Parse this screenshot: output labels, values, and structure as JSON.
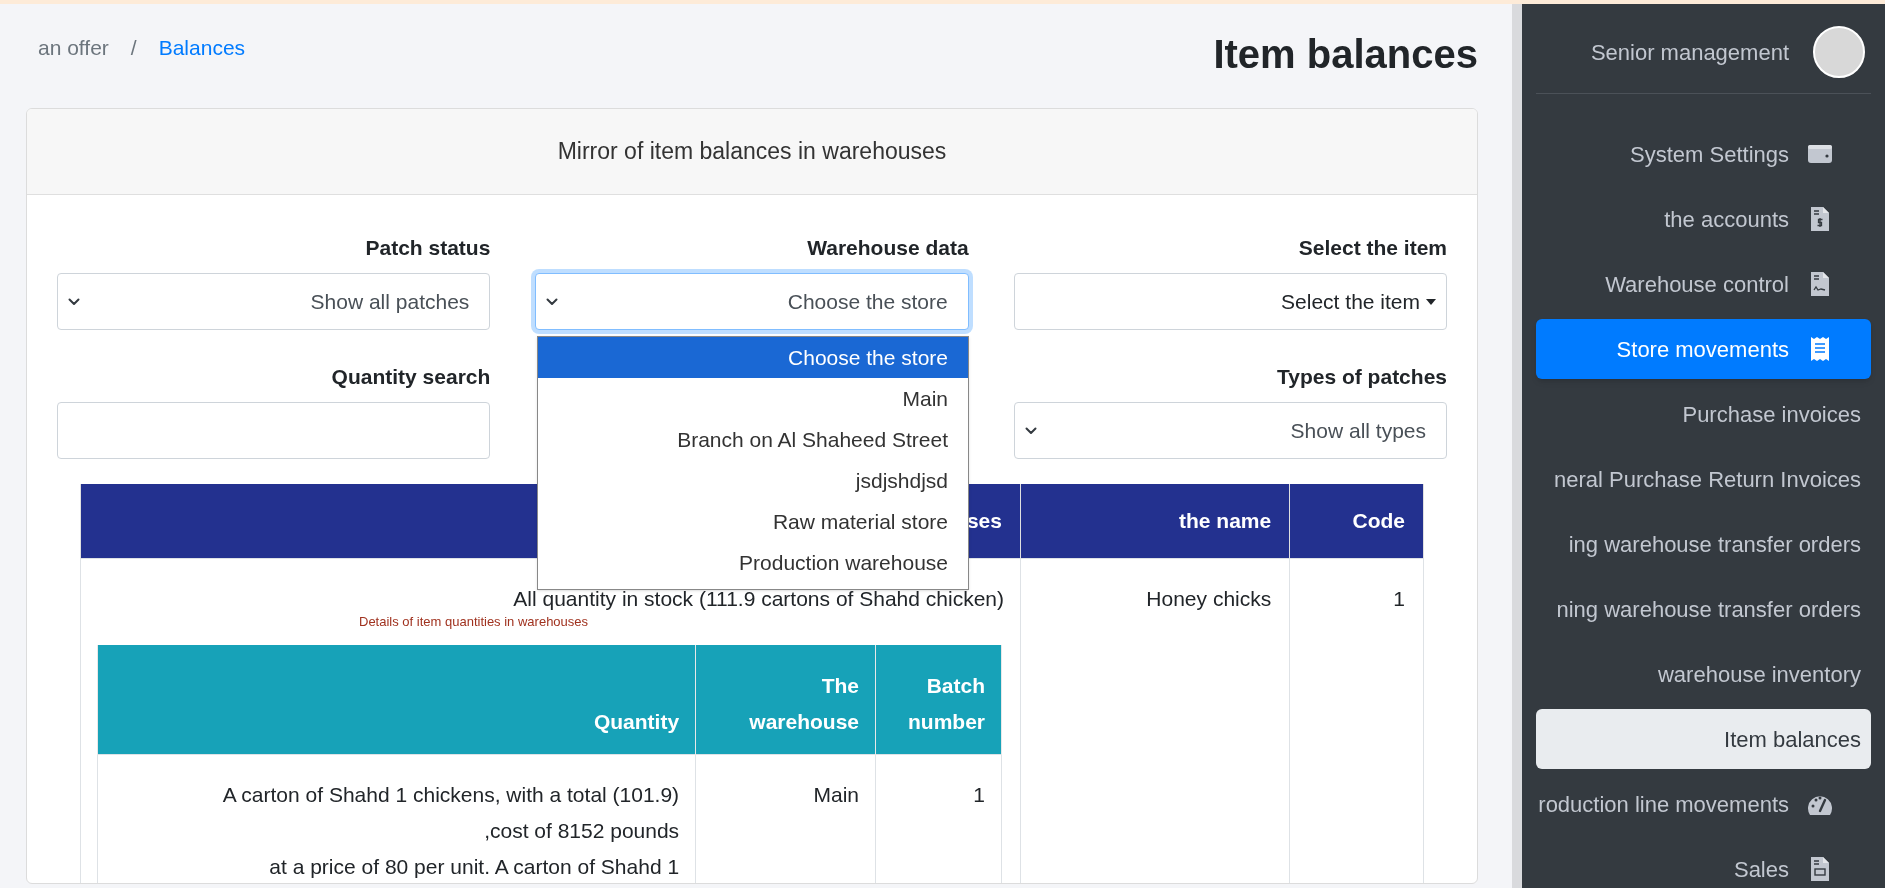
{
  "breadcrumb": {
    "separator": "/",
    "items": [
      {
        "label": "an offer",
        "link": false
      },
      {
        "label": "Balances",
        "link": true
      }
    ]
  },
  "page_title": "Item balances",
  "card": {
    "title": "Mirror of item balances in warehouses",
    "filters": [
      {
        "label": "Patch status",
        "kind": "select",
        "value": "Show all patches",
        "focused": false
      },
      {
        "label": "Warehouse data",
        "kind": "select",
        "value": "Choose the store",
        "focused": true
      },
      {
        "label": "Select the item",
        "kind": "picker",
        "value": "Select the item",
        "focused": false
      },
      {
        "label": "Quantity search",
        "kind": "input",
        "focused": false
      },
      {
        "kind": "hidden"
      },
      {
        "label": "Types of patches",
        "kind": "select",
        "value": "Show all types",
        "focused": false
      }
    ],
    "dropdown_options": [
      {
        "label": "Choose the store",
        "selected": true
      },
      {
        "label": "Main",
        "selected": false
      },
      {
        "label": "Branch on Al Shaheed Street",
        "selected": false
      },
      {
        "label": "jsdjshdjsd",
        "selected": false
      },
      {
        "label": "Raw material store",
        "selected": false
      },
      {
        "label": "Production warehouse",
        "selected": false
      }
    ],
    "table": {
      "columns": [
        "ses",
        "the name",
        "Code"
      ],
      "rows": [
        {
          "stock_total": "All quantity in stock (111.9 cartons of Shahd chicken)",
          "details_caption": "Details of item quantities in warehouses",
          "name": "Honey chicks",
          "code": "1",
          "details": {
            "columns": [
              "Quantity",
              "The warehouse",
              "Batch number"
            ],
            "rows": [
              [
                "A carton of Shahd 1 chickens, with a total (101.9)\n,cost of 8152 pounds\nat a price of 80 per unit. A carton of Shahd 1",
                "Main",
                "1"
              ]
            ]
          }
        }
      ]
    }
  },
  "sidebar": {
    "user": "Senior management",
    "items": [
      {
        "label": "System Settings",
        "kind": "group",
        "selected": false,
        "expanded": false
      },
      {
        "label": "the accounts",
        "kind": "group",
        "selected": false,
        "expanded": false
      },
      {
        "label": "Warehouse control",
        "kind": "group",
        "selected": false,
        "expanded": false
      },
      {
        "label": "Store movements",
        "kind": "group",
        "selected": false,
        "expanded": true
      },
      {
        "label": "Purchase invoices",
        "kind": "link",
        "selected": false,
        "expanded": false
      },
      {
        "label": "neral Purchase Return Invoices",
        "kind": "link",
        "selected": false,
        "expanded": false
      },
      {
        "label": "ing warehouse transfer orders",
        "kind": "link",
        "selected": false,
        "expanded": false
      },
      {
        "label": "ning warehouse transfer orders",
        "kind": "link",
        "selected": false,
        "expanded": false
      },
      {
        "label": "warehouse inventory",
        "kind": "link",
        "selected": false,
        "expanded": false
      },
      {
        "label": "Item balances",
        "kind": "link",
        "selected": true,
        "expanded": false
      },
      {
        "label": "roduction line movements",
        "kind": "group",
        "selected": false,
        "expanded": false
      },
      {
        "label": "Sales",
        "kind": "group",
        "selected": false,
        "expanded": false
      }
    ]
  }
}
